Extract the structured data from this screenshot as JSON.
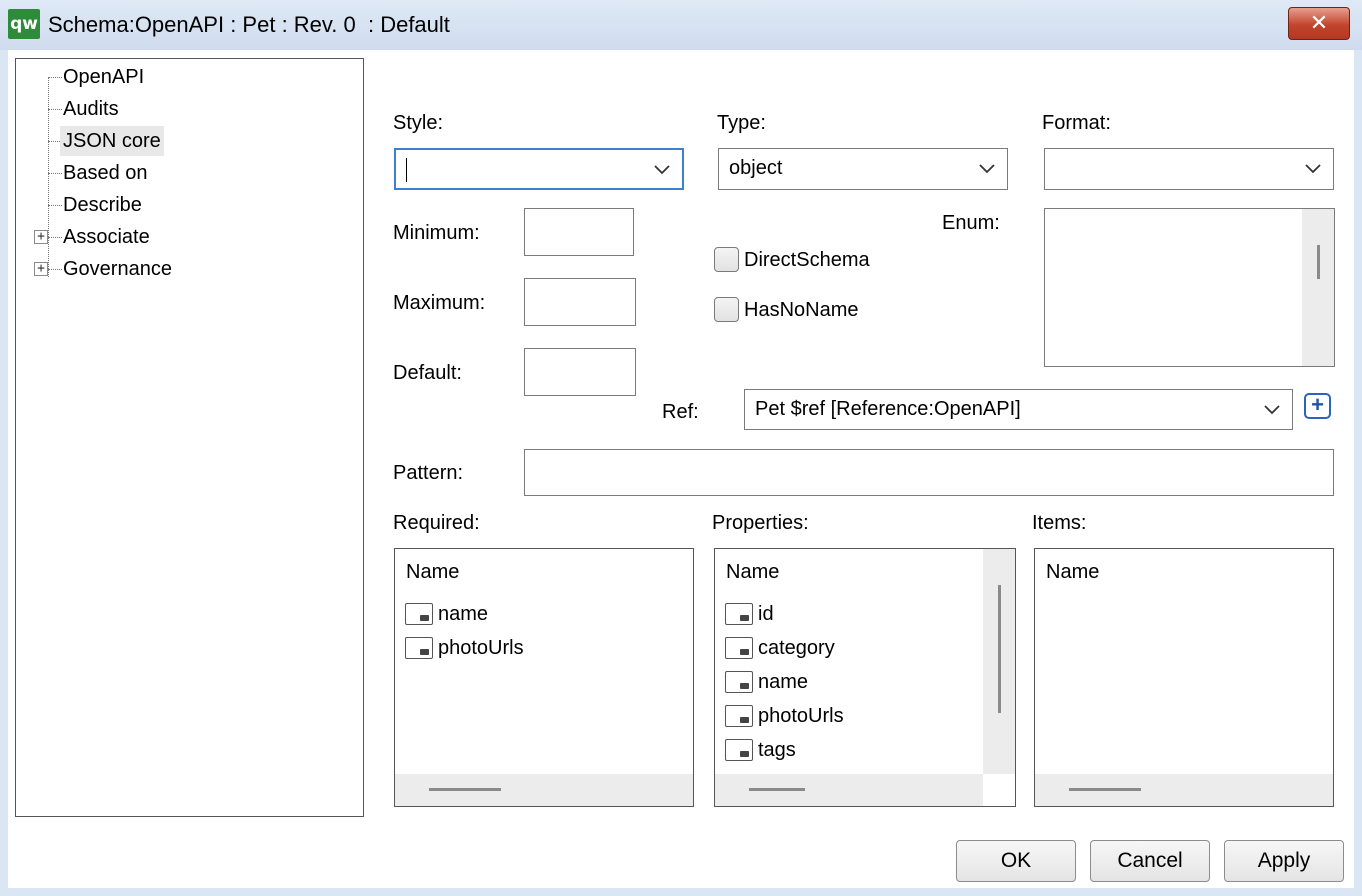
{
  "window": {
    "title": "Schema:OpenAPI : Pet : Rev. 0  : Default",
    "app_icon_text": "qw",
    "close_symbol": "✕"
  },
  "tree": {
    "items": [
      {
        "label": "OpenAPI",
        "expandable": false,
        "selected": false
      },
      {
        "label": "Audits",
        "expandable": false,
        "selected": false
      },
      {
        "label": "JSON core",
        "expandable": false,
        "selected": true
      },
      {
        "label": "Based on",
        "expandable": false,
        "selected": false
      },
      {
        "label": "Describe",
        "expandable": false,
        "selected": false
      },
      {
        "label": "Associate",
        "expandable": true,
        "selected": false
      },
      {
        "label": "Governance",
        "expandable": true,
        "selected": false
      }
    ],
    "expander_symbol": "+"
  },
  "form": {
    "style": {
      "label": "Style:",
      "value": ""
    },
    "type": {
      "label": "Type:",
      "value": "object"
    },
    "format": {
      "label": "Format:",
      "value": ""
    },
    "minimum": {
      "label": "Minimum:",
      "value": ""
    },
    "maximum": {
      "label": "Maximum:",
      "value": ""
    },
    "default": {
      "label": "Default:",
      "value": ""
    },
    "direct_schema": {
      "label": "DirectSchema",
      "checked": false
    },
    "has_no_name": {
      "label": "HasNoName",
      "checked": false
    },
    "enum": {
      "label": "Enum:"
    },
    "ref": {
      "label": "Ref:",
      "value": "Pet $ref [Reference:OpenAPI]",
      "add_symbol": "+"
    },
    "pattern": {
      "label": "Pattern:",
      "value": ""
    }
  },
  "lists": {
    "required": {
      "label": "Required:",
      "column": "Name",
      "rows": [
        "name",
        "photoUrls"
      ]
    },
    "properties": {
      "label": "Properties:",
      "column": "Name",
      "rows": [
        "id",
        "category",
        "name",
        "photoUrls",
        "tags"
      ]
    },
    "items": {
      "label": "Items:",
      "column": "Name",
      "rows": []
    }
  },
  "buttons": {
    "ok": "OK",
    "cancel": "Cancel",
    "apply": "Apply"
  },
  "colors": {
    "accent": "#3c7fd6",
    "close": "#c2452e",
    "app_icon": "#2e8b3a"
  }
}
